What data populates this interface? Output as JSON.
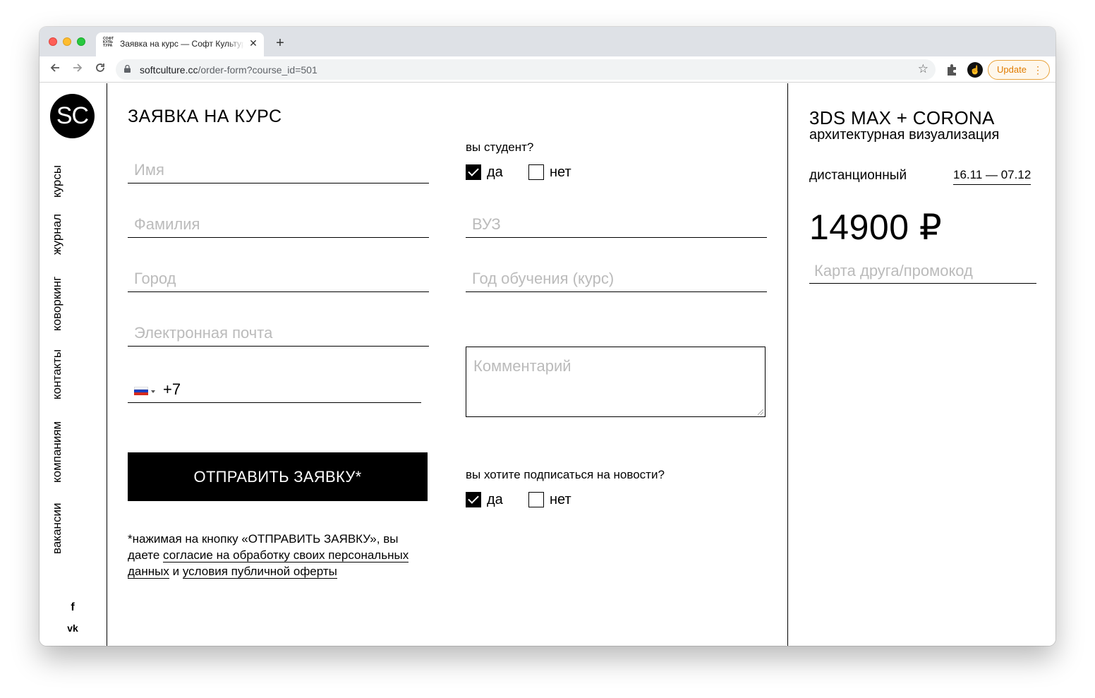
{
  "browser": {
    "tab_title": "Заявка на курс — Софт Культура",
    "tab_favicon_text": "СОФТ КУЛЬ ТУРА",
    "tab_close": "✕",
    "new_tab": "+",
    "url_domain": "softculture.cc",
    "url_path": "/order-form?course_id=501",
    "update_label": "Update",
    "profile_initial": "☝"
  },
  "sidebar": {
    "logo": "SC",
    "nav": [
      "курсы",
      "журнал",
      "коворкинг",
      "контакты",
      "компаниям",
      "вакансии"
    ],
    "social": [
      "f",
      "vk"
    ]
  },
  "form": {
    "title": "ЗАЯВКА НА КУРС",
    "fields": {
      "name": "Имя",
      "surname": "Фамилия",
      "city": "Город",
      "email": "Электронная почта",
      "phone_code": "+7",
      "university": "ВУЗ",
      "study_year": "Год обучения (курс)",
      "comment": "Комментарий"
    },
    "student_question": "вы студент?",
    "student_yes": "да",
    "student_no": "нет",
    "newsletter_question": "вы хотите подписаться на новости?",
    "newsletter_yes": "да",
    "newsletter_no": "нет",
    "submit": "ОТПРАВИТЬ ЗАЯВКУ*",
    "legal_prefix": "*нажимая на кнопку «ОТПРАВИТЬ ЗАЯВКУ», вы даете ",
    "legal_link1": "согласие на обработку своих персональных данных",
    "legal_middle": " и ",
    "legal_link2": "условия публичной оферты"
  },
  "course": {
    "name": "3DS MAX + CORONA",
    "subtitle": "архитектурная визуализация",
    "format": "дистанционный",
    "dates": "16.11 — 07.12",
    "price": "14900 ₽",
    "promo_placeholder": "Карта друга/промокод"
  },
  "colors": {
    "accent": "#000000",
    "placeholder": "#bbbbbb",
    "update": "#e07c00"
  }
}
